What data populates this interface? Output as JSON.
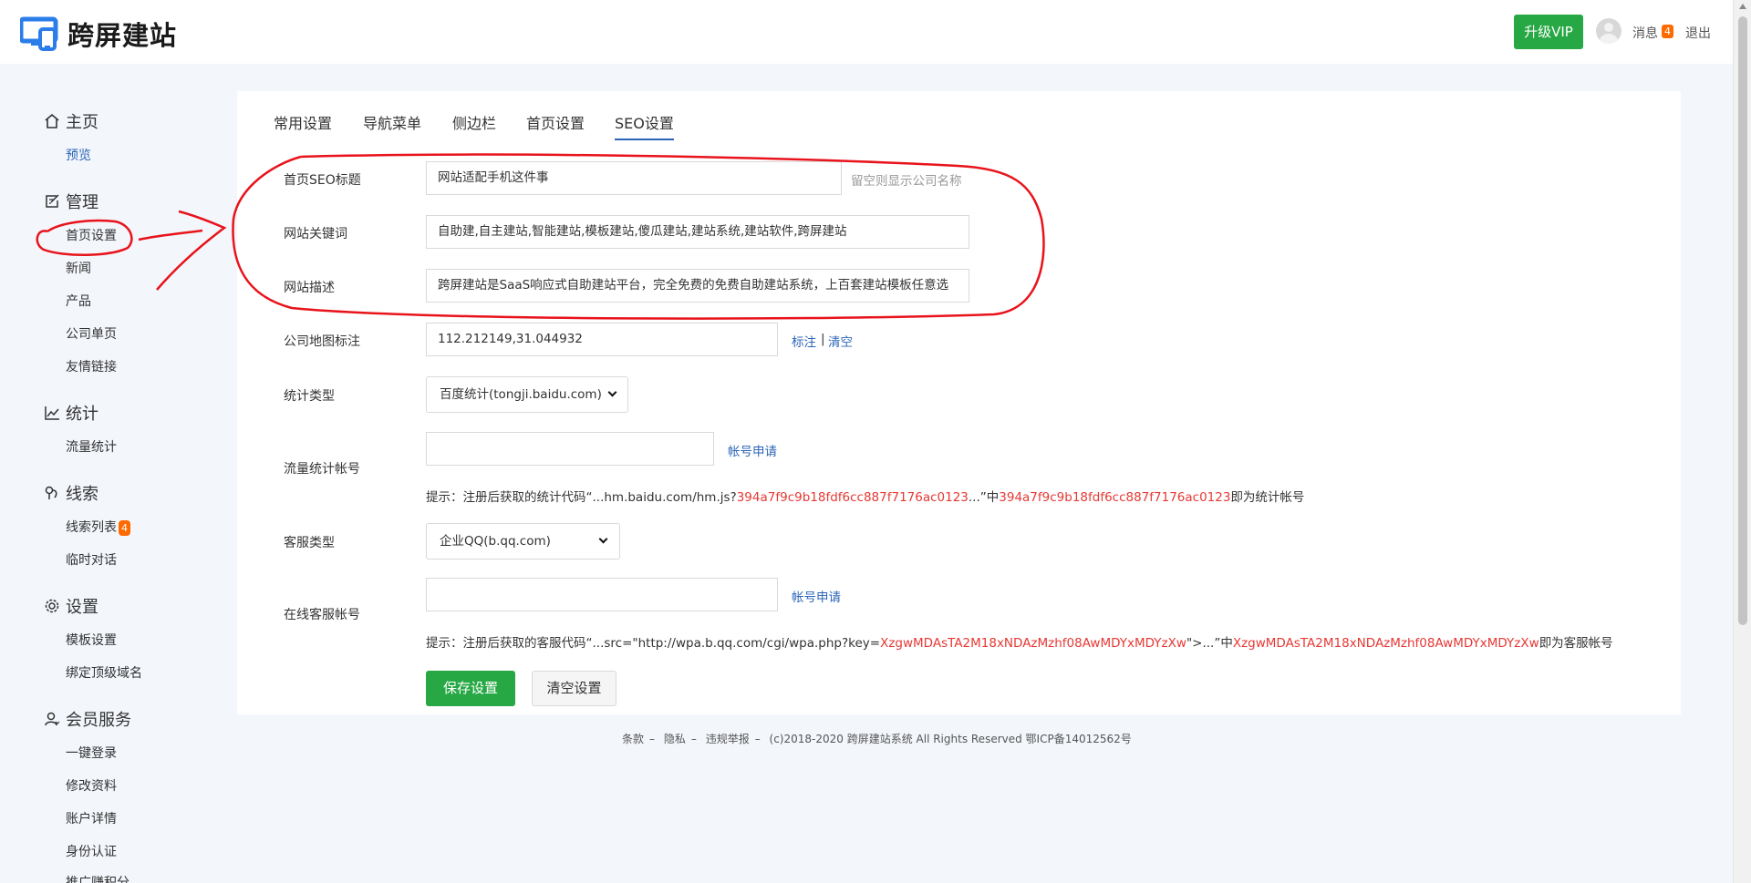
{
  "header": {
    "logo_text": "跨屏建站",
    "vip_button": "升级VIP",
    "messages_label": "消息",
    "messages_count": "4",
    "logout_label": "退出"
  },
  "sidebar": {
    "home": {
      "title": "主页",
      "items": [
        "预览"
      ]
    },
    "manage": {
      "title": "管理",
      "items": [
        "首页设置",
        "新闻",
        "产品",
        "公司单页",
        "友情链接"
      ]
    },
    "stats": {
      "title": "统计",
      "items": [
        "流量统计"
      ]
    },
    "leads": {
      "title": "线索",
      "items": [
        "线索列表",
        "临时对话"
      ],
      "badge": "4"
    },
    "settings": {
      "title": "设置",
      "items": [
        "模板设置",
        "绑定顶级域名"
      ]
    },
    "member": {
      "title": "会员服务",
      "items": [
        "一键登录",
        "修改资料",
        "账户详情",
        "身份认证",
        "推广赚积分"
      ]
    }
  },
  "tabs": [
    "常用设置",
    "导航菜单",
    "侧边栏",
    "首页设置",
    "SEO设置"
  ],
  "active_tab": "SEO设置",
  "form": {
    "seo_title": {
      "label": "首页SEO标题",
      "value": "网站适配手机这件事",
      "hint": "留空则显示公司名称"
    },
    "keywords": {
      "label": "网站关键词",
      "value": "自助建,自主建站,智能建站,模板建站,傻瓜建站,建站系统,建站软件,跨屏建站"
    },
    "description": {
      "label": "网站描述",
      "value": "跨屏建站是SaaS响应式自助建站平台，完全免费的免费自助建站系统，上百套建站模板任意选"
    },
    "map": {
      "label": "公司地图标注",
      "value": "112.212149,31.044932",
      "mark_link": "标注",
      "separator": "|",
      "clear_link": "清空"
    },
    "stat_type": {
      "label": "统计类型",
      "selected": "百度统计(tongji.baidu.com)"
    },
    "stat_account": {
      "label": "流量统计帐号",
      "value": "",
      "apply_link": "帐号申请",
      "tip_prefix": "提示：注册后获取的统计代码“...hm.baidu.com/hm.js?",
      "tip_code": "394a7f9c9b18fdf6cc887f7176ac0123",
      "tip_mid": "...”中",
      "tip_code2": "394a7f9c9b18fdf6cc887f7176ac0123",
      "tip_suffix": "即为统计帐号"
    },
    "service_type": {
      "label": "客服类型",
      "selected": "企业QQ(b.qq.com)"
    },
    "service_account": {
      "label": "在线客服帐号",
      "value": "",
      "apply_link": "帐号申请",
      "tip_prefix": "提示：注册后获取的客服代码“...src=\"http://wpa.b.qq.com/cgi/wpa.php?key=",
      "tip_code": "XzgwMDAsTA2M18xNDAzMzhf08AwMDYxMDYzXw",
      "tip_mid": "\">...”中",
      "tip_code2": "XzgwMDAsTA2M18xNDAzMzhf08AwMDYxMDYzXw",
      "tip_suffix": "即为客服帐号"
    },
    "save_button": "保存设置",
    "clear_button": "清空设置"
  },
  "footer": {
    "terms": "条款",
    "privacy": "隐私",
    "report": "违规举报",
    "dash": "–",
    "copyright": "(c)2018-2020 跨屏建站系统 All Rights Reserved 鄂ICP备14012562号"
  },
  "colors": {
    "accent_green": "#27a844",
    "link_blue": "#2b65b8",
    "badge_orange": "#ff6a00",
    "tip_red": "#e53935",
    "annotation_red": "#e8131b"
  }
}
